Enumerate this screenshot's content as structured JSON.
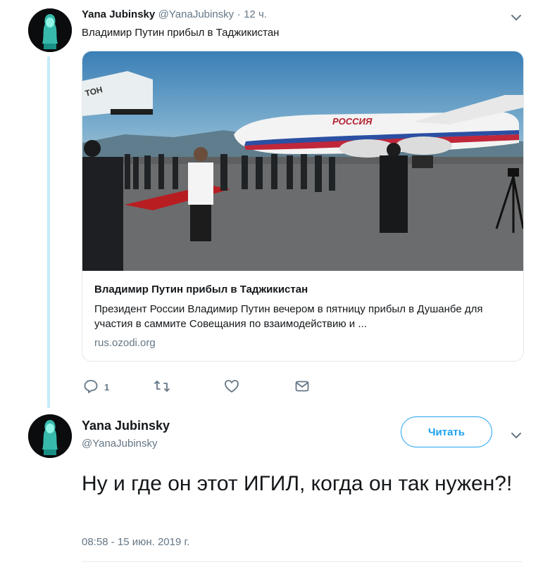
{
  "parent_tweet": {
    "display_name": "Yana Jubinsky",
    "handle": "@YanaJubinsky",
    "separator": "·",
    "time_ago": "12 ч.",
    "text": "Владимир Путин прибыл в Таджикистан",
    "card": {
      "title": "Владимир Путин прибыл в Таджикистан",
      "description": "Президент России Владимир Путин вечером в пятницу прибыл в Душанбе для участия в саммите Совещания по взаимодействию и ...",
      "domain": "rus.ozodi.org",
      "image_text": {
        "plane_lettering": "РОССИЯ",
        "stair_lettering": "ТОН"
      }
    },
    "actions": {
      "reply_count": "1"
    }
  },
  "main_tweet": {
    "display_name": "Yana Jubinsky",
    "handle": "@YanaJubinsky",
    "follow_label": "Читать",
    "text": "Ну и где он этот ИГИЛ, когда он так нужен?!",
    "timestamp": "08:58 - 15 июн. 2019 г."
  },
  "colors": {
    "accent": "#1da1f2",
    "muted": "#657786",
    "thread_line": "#c4ecf9"
  },
  "icons": [
    "reply-icon",
    "retweet-icon",
    "like-icon",
    "message-icon",
    "chevron-down-icon"
  ]
}
